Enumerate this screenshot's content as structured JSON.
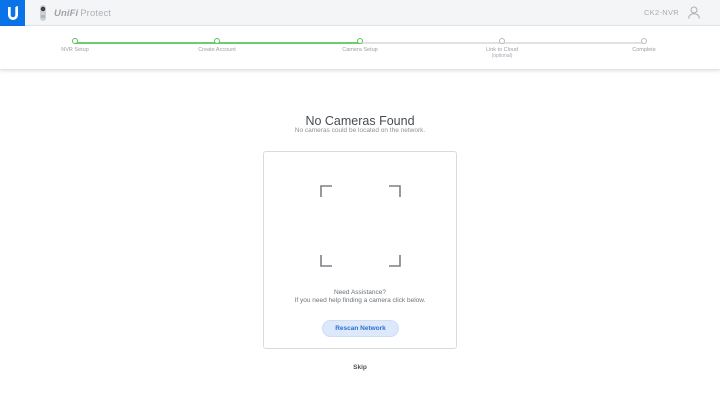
{
  "header": {
    "brand": {
      "name": "UniFi",
      "product": "Protect"
    },
    "device_name": "CK2-NVR"
  },
  "steps": [
    {
      "label": "NVR Setup",
      "sub": "",
      "status": "complete"
    },
    {
      "label": "Create Account",
      "sub": "",
      "status": "complete"
    },
    {
      "label": "Camera Setup",
      "sub": "",
      "status": "current"
    },
    {
      "label": "Link to Cloud",
      "sub": "(optional)",
      "status": "pending"
    },
    {
      "label": "Complete",
      "sub": "",
      "status": "pending"
    }
  ],
  "main": {
    "title": "No Cameras Found",
    "subtitle": "No cameras could be located on the network."
  },
  "card": {
    "icon": "camera-frame-icon",
    "assist_title": "Need Assistance?",
    "assist_text": "If you need help finding a camera click below.",
    "rescan_label": "Rescan Network"
  },
  "skip_label": "Skip",
  "colors": {
    "brand_blue": "#0a73e8",
    "progress_green": "#6dcc6d",
    "button_bg": "#dde9fb",
    "button_text": "#2a6fd0"
  }
}
